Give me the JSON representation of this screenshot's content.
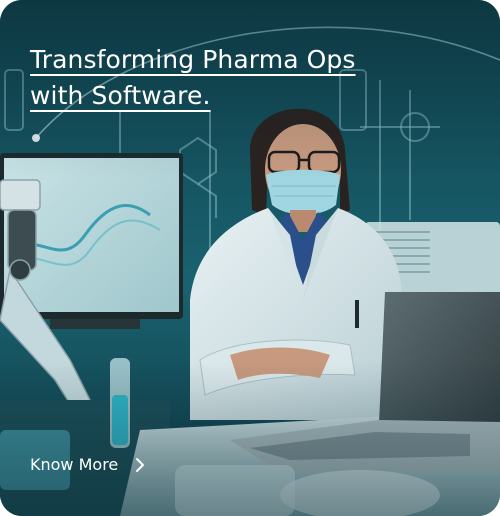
{
  "card": {
    "headline_line1": "Transforming Pharma Ops",
    "headline_line2": "with Software.",
    "cta_label": "Know More",
    "cta_icon": "chevron-right-icon",
    "colors": {
      "background": "#145663",
      "text": "#ffffff",
      "accent_teal": "#2aa6b8"
    }
  }
}
